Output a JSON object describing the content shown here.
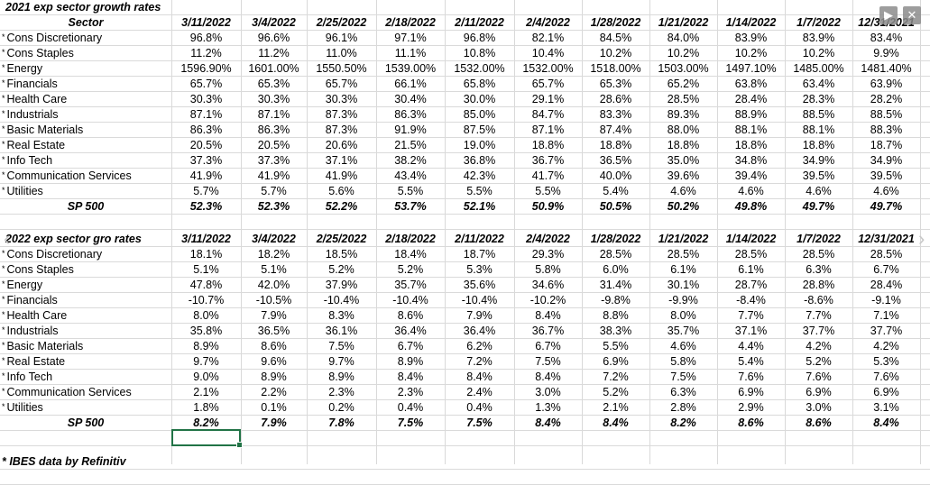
{
  "section1": {
    "title": "2021 exp sector growth rates",
    "sector_header": "Sector",
    "dates": [
      "3/11/2022",
      "3/4/2022",
      "2/25/2022",
      "2/18/2022",
      "2/11/2022",
      "2/4/2022",
      "1/28/2022",
      "1/21/2022",
      "1/14/2022",
      "1/7/2022",
      "12/31/2021"
    ],
    "rows": [
      {
        "label": "Cons Discretionary",
        "values": [
          "96.8%",
          "96.6%",
          "96.1%",
          "97.1%",
          "96.8%",
          "82.1%",
          "84.5%",
          "84.0%",
          "83.9%",
          "83.9%",
          "83.4%"
        ]
      },
      {
        "label": "Cons Staples",
        "values": [
          "11.2%",
          "11.2%",
          "11.0%",
          "11.1%",
          "10.8%",
          "10.4%",
          "10.2%",
          "10.2%",
          "10.2%",
          "10.2%",
          "9.9%"
        ]
      },
      {
        "label": "Energy",
        "values": [
          "1596.90%",
          "1601.00%",
          "1550.50%",
          "1539.00%",
          "1532.00%",
          "1532.00%",
          "1518.00%",
          "1503.00%",
          "1497.10%",
          "1485.00%",
          "1481.40%"
        ]
      },
      {
        "label": "Financials",
        "values": [
          "65.7%",
          "65.3%",
          "65.7%",
          "66.1%",
          "65.8%",
          "65.7%",
          "65.3%",
          "65.2%",
          "63.8%",
          "63.4%",
          "63.9%"
        ]
      },
      {
        "label": "Health Care",
        "values": [
          "30.3%",
          "30.3%",
          "30.3%",
          "30.4%",
          "30.0%",
          "29.1%",
          "28.6%",
          "28.5%",
          "28.4%",
          "28.3%",
          "28.2%"
        ]
      },
      {
        "label": "Industrials",
        "values": [
          "87.1%",
          "87.1%",
          "87.3%",
          "86.3%",
          "85.0%",
          "84.7%",
          "83.3%",
          "89.3%",
          "88.9%",
          "88.5%",
          "88.5%"
        ]
      },
      {
        "label": "Basic Materials",
        "values": [
          "86.3%",
          "86.3%",
          "87.3%",
          "91.9%",
          "87.5%",
          "87.1%",
          "87.4%",
          "88.0%",
          "88.1%",
          "88.1%",
          "88.3%"
        ]
      },
      {
        "label": "Real Estate",
        "values": [
          "20.5%",
          "20.5%",
          "20.6%",
          "21.5%",
          "19.0%",
          "18.8%",
          "18.8%",
          "18.8%",
          "18.8%",
          "18.8%",
          "18.7%"
        ]
      },
      {
        "label": "Info Tech",
        "values": [
          "37.3%",
          "37.3%",
          "37.1%",
          "38.2%",
          "36.8%",
          "36.7%",
          "36.5%",
          "35.0%",
          "34.8%",
          "34.9%",
          "34.9%"
        ]
      },
      {
        "label": "Communication Services",
        "values": [
          "41.9%",
          "41.9%",
          "41.9%",
          "43.4%",
          "42.3%",
          "41.7%",
          "40.0%",
          "39.6%",
          "39.4%",
          "39.5%",
          "39.5%"
        ]
      },
      {
        "label": "Utilities",
        "values": [
          "5.7%",
          "5.7%",
          "5.6%",
          "5.5%",
          "5.5%",
          "5.5%",
          "5.4%",
          "4.6%",
          "4.6%",
          "4.6%",
          "4.6%"
        ]
      }
    ],
    "total": {
      "label": "SP 500",
      "values": [
        "52.3%",
        "52.3%",
        "52.2%",
        "53.7%",
        "52.1%",
        "50.9%",
        "50.5%",
        "50.2%",
        "49.8%",
        "49.7%",
        "49.7%"
      ]
    }
  },
  "section2": {
    "title": "2022 exp sector gro rates",
    "dates": [
      "3/11/2022",
      "3/4/2022",
      "2/25/2022",
      "2/18/2022",
      "2/11/2022",
      "2/4/2022",
      "1/28/2022",
      "1/21/2022",
      "1/14/2022",
      "1/7/2022",
      "12/31/2021"
    ],
    "rows": [
      {
        "label": "Cons Discretionary",
        "values": [
          "18.1%",
          "18.2%",
          "18.5%",
          "18.4%",
          "18.7%",
          "29.3%",
          "28.5%",
          "28.5%",
          "28.5%",
          "28.5%",
          "28.5%"
        ]
      },
      {
        "label": "Cons Staples",
        "values": [
          "5.1%",
          "5.1%",
          "5.2%",
          "5.2%",
          "5.3%",
          "5.8%",
          "6.0%",
          "6.1%",
          "6.1%",
          "6.3%",
          "6.7%"
        ]
      },
      {
        "label": "Energy",
        "values": [
          "47.8%",
          "42.0%",
          "37.9%",
          "35.7%",
          "35.6%",
          "34.6%",
          "31.4%",
          "30.1%",
          "28.7%",
          "28.8%",
          "28.4%"
        ]
      },
      {
        "label": "Financials",
        "values": [
          "-10.7%",
          "-10.5%",
          "-10.4%",
          "-10.4%",
          "-10.4%",
          "-10.2%",
          "-9.8%",
          "-9.9%",
          "-8.4%",
          "-8.6%",
          "-9.1%"
        ]
      },
      {
        "label": "Health Care",
        "values": [
          "8.0%",
          "7.9%",
          "8.3%",
          "8.6%",
          "7.9%",
          "8.4%",
          "8.8%",
          "8.0%",
          "7.7%",
          "7.7%",
          "7.1%"
        ]
      },
      {
        "label": "Industrials",
        "values": [
          "35.8%",
          "36.5%",
          "36.1%",
          "36.4%",
          "36.4%",
          "36.7%",
          "38.3%",
          "35.7%",
          "37.1%",
          "37.7%",
          "37.7%"
        ]
      },
      {
        "label": "Basic Materials",
        "values": [
          "8.9%",
          "8.6%",
          "7.5%",
          "6.7%",
          "6.2%",
          "6.7%",
          "5.5%",
          "4.6%",
          "4.4%",
          "4.2%",
          "4.2%"
        ]
      },
      {
        "label": "Real Estate",
        "values": [
          "9.7%",
          "9.6%",
          "9.7%",
          "8.9%",
          "7.2%",
          "7.5%",
          "6.9%",
          "5.8%",
          "5.4%",
          "5.2%",
          "5.3%"
        ]
      },
      {
        "label": "Info Tech",
        "values": [
          "9.0%",
          "8.9%",
          "8.9%",
          "8.4%",
          "8.4%",
          "8.4%",
          "7.2%",
          "7.5%",
          "7.6%",
          "7.6%",
          "7.6%"
        ]
      },
      {
        "label": "Communication Services",
        "values": [
          "2.1%",
          "2.2%",
          "2.3%",
          "2.3%",
          "2.4%",
          "3.0%",
          "5.2%",
          "6.3%",
          "6.9%",
          "6.9%",
          "6.9%"
        ]
      },
      {
        "label": "Utilities",
        "values": [
          "1.8%",
          "0.1%",
          "0.2%",
          "0.4%",
          "0.4%",
          "1.3%",
          "2.1%",
          "2.8%",
          "2.9%",
          "3.0%",
          "3.1%"
        ]
      }
    ],
    "total": {
      "label": "SP 500",
      "values": [
        "8.2%",
        "7.9%",
        "7.8%",
        "7.5%",
        "7.5%",
        "8.4%",
        "8.4%",
        "8.2%",
        "8.6%",
        "8.6%",
        "8.4%"
      ]
    }
  },
  "footnote": "* IBES data by Refinitiv",
  "asterisk": "*",
  "overlay": {
    "play_icon": "▶",
    "close_icon": "✕",
    "prev_icon": "‹",
    "next_icon": "›"
  },
  "selection_color": "#217346"
}
